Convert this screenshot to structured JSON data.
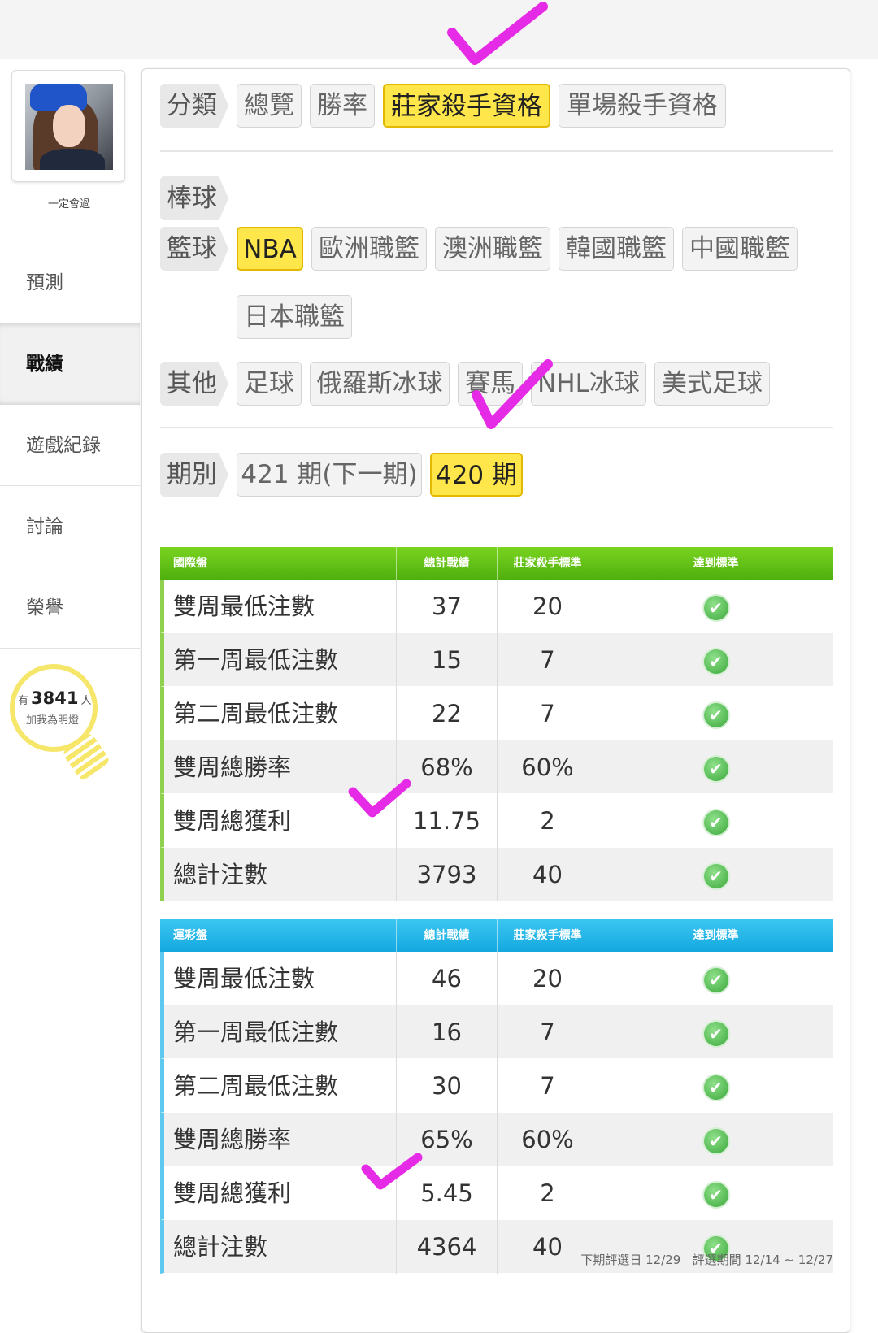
{
  "user": {
    "username": "一定會過"
  },
  "nav": {
    "items": [
      {
        "label": "預測"
      },
      {
        "label": "戰績"
      },
      {
        "label": "遊戲紀錄"
      },
      {
        "label": "討論"
      },
      {
        "label": "榮譽"
      }
    ]
  },
  "lamp": {
    "prefix": "有",
    "count": "3841",
    "suffix": "人",
    "cta": "加我為明燈"
  },
  "filters": {
    "category": {
      "label": "分類",
      "options": [
        "總覽",
        "勝率",
        "莊家殺手資格",
        "單場殺手資格"
      ],
      "selected": "莊家殺手資格"
    },
    "baseball": {
      "label": "棒球"
    },
    "basketball": {
      "label": "籃球",
      "options": [
        "NBA",
        "歐洲職籃",
        "澳洲職籃",
        "韓國職籃",
        "中國職籃",
        "日本職籃"
      ],
      "selected": "NBA"
    },
    "other": {
      "label": "其他",
      "options": [
        "足球",
        "俄羅斯冰球",
        "賽馬",
        "NHL冰球",
        "美式足球"
      ]
    },
    "period": {
      "label": "期別",
      "options": [
        "421 期(下一期)",
        "420 期"
      ],
      "selected": "420 期"
    }
  },
  "tables": [
    {
      "title": "國際盤",
      "headers": [
        "總計戰績",
        "莊家殺手標準",
        "達到標準"
      ],
      "accent": "#5db815",
      "rows": [
        {
          "label": "雙周最低注數",
          "total": "37",
          "standard": "20",
          "met": true
        },
        {
          "label": "第一周最低注數",
          "total": "15",
          "standard": "7",
          "met": true
        },
        {
          "label": "第二周最低注數",
          "total": "22",
          "standard": "7",
          "met": true
        },
        {
          "label": "雙周總勝率",
          "total": "68%",
          "standard": "60%",
          "met": true
        },
        {
          "label": "雙周總獲利",
          "total": "11.75",
          "standard": "2",
          "met": true
        },
        {
          "label": "總計注數",
          "total": "3793",
          "standard": "40",
          "met": true
        }
      ]
    },
    {
      "title": "運彩盤",
      "headers": [
        "總計戰績",
        "莊家殺手標準",
        "達到標準"
      ],
      "accent": "#1cb0e6",
      "rows": [
        {
          "label": "雙周最低注數",
          "total": "46",
          "standard": "20",
          "met": true
        },
        {
          "label": "第一周最低注數",
          "total": "16",
          "standard": "7",
          "met": true
        },
        {
          "label": "第二周最低注數",
          "total": "30",
          "standard": "7",
          "met": true
        },
        {
          "label": "雙周總勝率",
          "total": "65%",
          "standard": "60%",
          "met": true
        },
        {
          "label": "雙周總獲利",
          "total": "5.45",
          "standard": "2",
          "met": true
        },
        {
          "label": "總計注數",
          "total": "4364",
          "standard": "40",
          "met": true
        }
      ]
    }
  ],
  "footer": {
    "next_review": "下期評選日 12/29",
    "review_period": "評選期間 12/14 ~ 12/27"
  },
  "icons": {
    "check": "check-circle-icon",
    "pen_mark": "checkmark-annotation-icon"
  },
  "colors": {
    "selected_tag": "#ffe64a",
    "pen_mark": "#e62be6"
  }
}
